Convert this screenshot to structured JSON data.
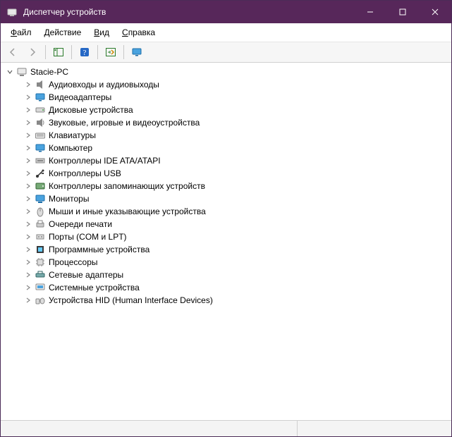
{
  "window": {
    "title": "Диспетчер устройств"
  },
  "menu": {
    "items": [
      {
        "label": "Файл",
        "hotchar": "Ф"
      },
      {
        "label": "Действие",
        "hotchar": "Д"
      },
      {
        "label": "Вид",
        "hotchar": "В"
      },
      {
        "label": "Справка",
        "hotchar": "С"
      }
    ]
  },
  "toolbar": {
    "back": "Назад",
    "forward": "Вперёд",
    "show_hide": "Показать/скрыть дерево",
    "help": "Справка",
    "scan": "Обновить конфигурацию",
    "monitors": "Показать устройства"
  },
  "tree": {
    "root": {
      "label": "Stacie-PC",
      "expanded": true
    },
    "items": [
      {
        "icon": "audio",
        "label": "Аудиовходы и аудиовыходы"
      },
      {
        "icon": "display",
        "label": "Видеоадаптеры"
      },
      {
        "icon": "disk",
        "label": "Дисковые устройства"
      },
      {
        "icon": "sound",
        "label": "Звуковые, игровые и видеоустройства"
      },
      {
        "icon": "keyboard",
        "label": "Клавиатуры"
      },
      {
        "icon": "computer",
        "label": "Компьютер"
      },
      {
        "icon": "ide",
        "label": "Контроллеры IDE ATA/ATAPI"
      },
      {
        "icon": "usb",
        "label": "Контроллеры USB"
      },
      {
        "icon": "storage",
        "label": "Контроллеры запоминающих устройств"
      },
      {
        "icon": "monitor",
        "label": "Мониторы"
      },
      {
        "icon": "mouse",
        "label": "Мыши и иные указывающие устройства"
      },
      {
        "icon": "printq",
        "label": "Очереди печати"
      },
      {
        "icon": "ports",
        "label": "Порты (COM и LPT)"
      },
      {
        "icon": "software",
        "label": "Программные устройства"
      },
      {
        "icon": "cpu",
        "label": "Процессоры"
      },
      {
        "icon": "network",
        "label": "Сетевые адаптеры"
      },
      {
        "icon": "system",
        "label": "Системные устройства"
      },
      {
        "icon": "hid",
        "label": "Устройства HID (Human Interface Devices)"
      }
    ]
  }
}
